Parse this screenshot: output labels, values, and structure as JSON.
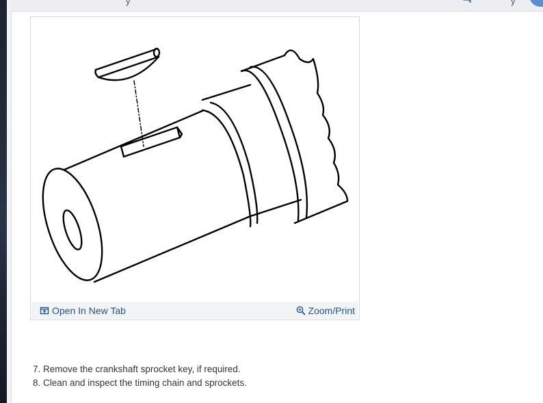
{
  "header": {
    "left_fragment": "y",
    "right_fragment": "y"
  },
  "figure": {
    "open_tab_label": "Open In New Tab",
    "zoom_label": "Zoom/Print"
  },
  "steps": [
    "7. Remove the crankshaft sprocket key, if required.",
    "8. Clean and inspect the timing chain and sprockets."
  ],
  "colors": {
    "link": "#24528d",
    "avatar": "#5a8fd0"
  }
}
